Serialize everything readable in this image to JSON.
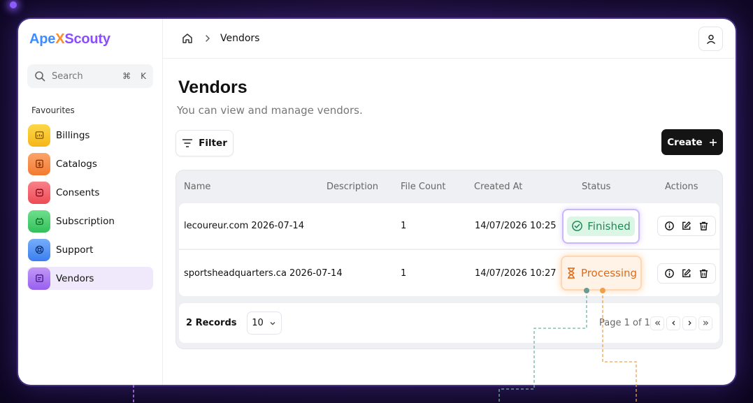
{
  "app": {
    "logo": {
      "part1": "Ape",
      "part2": "X",
      "part3": "Scouty"
    }
  },
  "sidebar": {
    "search": {
      "placeholder": "Search",
      "shortcut_symbol": "⌘",
      "shortcut_key": "K"
    },
    "favourites_label": "Favourites",
    "items": [
      {
        "label": "Billings",
        "icon": "billing-icon",
        "color": "#f7c62f"
      },
      {
        "label": "Catalogs",
        "icon": "catalog-icon",
        "color": "#f8914e"
      },
      {
        "label": "Consents",
        "icon": "consent-icon",
        "color": "#f2636b"
      },
      {
        "label": "Subscription",
        "icon": "subscription-icon",
        "color": "#48cf6e"
      },
      {
        "label": "Support",
        "icon": "support-icon",
        "color": "#4c8ff5"
      },
      {
        "label": "Vendors",
        "icon": "vendors-icon",
        "color": "#a874f2",
        "active": true
      }
    ]
  },
  "header": {
    "breadcrumb": "Vendors"
  },
  "page": {
    "title": "Vendors",
    "subtitle": "You can view and manage vendors.",
    "filter_label": "Filter",
    "create_label": "Create"
  },
  "table": {
    "columns": [
      "Name",
      "Description",
      "File Count",
      "Created At",
      "Status",
      "Actions"
    ],
    "rows": [
      {
        "name": "lecoureur.com 2026-07-14",
        "description": "",
        "file_count": "1",
        "created_at": "14/07/2026 10:25",
        "status": "Finished"
      },
      {
        "name": "sportsheadquarters.ca 2026-07-14",
        "description": "",
        "file_count": "1",
        "created_at": "14/07/2026 10:27",
        "status": "Processing"
      }
    ],
    "footer": {
      "records": "2 Records",
      "page_size": "10",
      "page_info": "Page 1 of 1"
    }
  },
  "colors": {
    "accent": "#8a4dff",
    "finished": "#1f8a55",
    "processing": "#e06a16",
    "primary_button": "#141414"
  }
}
